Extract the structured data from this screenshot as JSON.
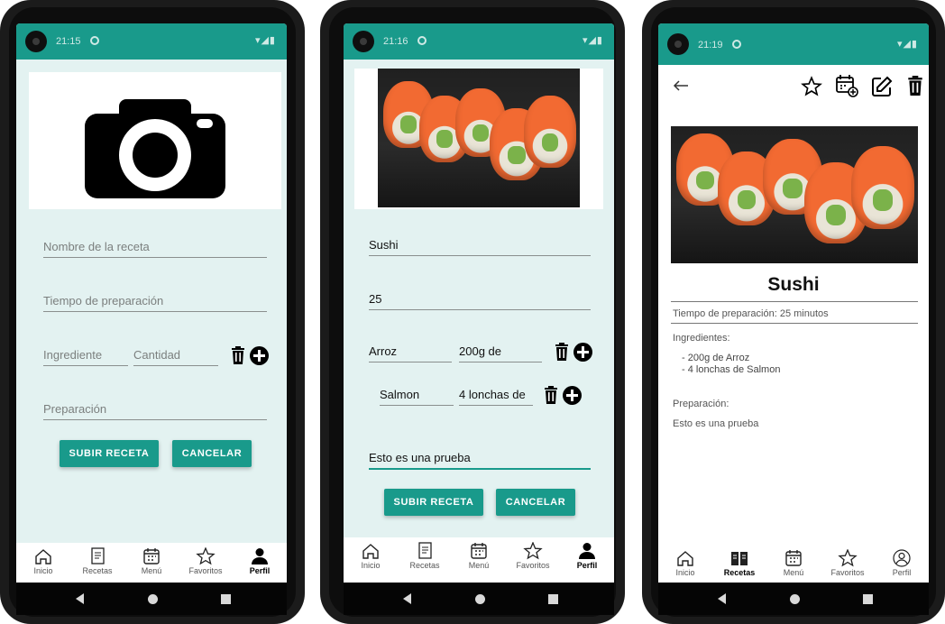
{
  "status": {
    "time_1": "21:15",
    "time_2": "21:16",
    "time_3": "21:19"
  },
  "form_empty": {
    "name_placeholder": "Nombre de la receta",
    "time_placeholder": "Tiempo de preparación",
    "ingredient_placeholder": "Ingrediente",
    "quantity_placeholder": "Cantidad",
    "preparation_placeholder": "Preparación",
    "submit_label": "SUBIR RECETA",
    "cancel_label": "CANCELAR"
  },
  "form_filled": {
    "name_value": "Sushi",
    "time_value": "25",
    "ingredients": [
      {
        "ingredient": "Arroz",
        "quantity": "200g de"
      },
      {
        "ingredient": "Salmon",
        "quantity": "4 lonchas de"
      }
    ],
    "preparation_value": "Esto es una prueba",
    "submit_label": "SUBIR RECETA",
    "cancel_label": "CANCELAR"
  },
  "detail": {
    "title": "Sushi",
    "prep_time": "Tiempo de preparación: 25 minutos",
    "ingredients_label": "Ingredientes:",
    "ingredient_lines": [
      "- 200g de  Arroz",
      "- 4 lonchas de Salmon"
    ],
    "preparation_label": "Preparación:",
    "preparation_text": "Esto es una prueba"
  },
  "nav": {
    "items": [
      "Inicio",
      "Recetas",
      "Menú",
      "Favoritos",
      "Perfil"
    ]
  },
  "colors": {
    "primary": "#199a8b",
    "background": "#e3f2f1"
  }
}
